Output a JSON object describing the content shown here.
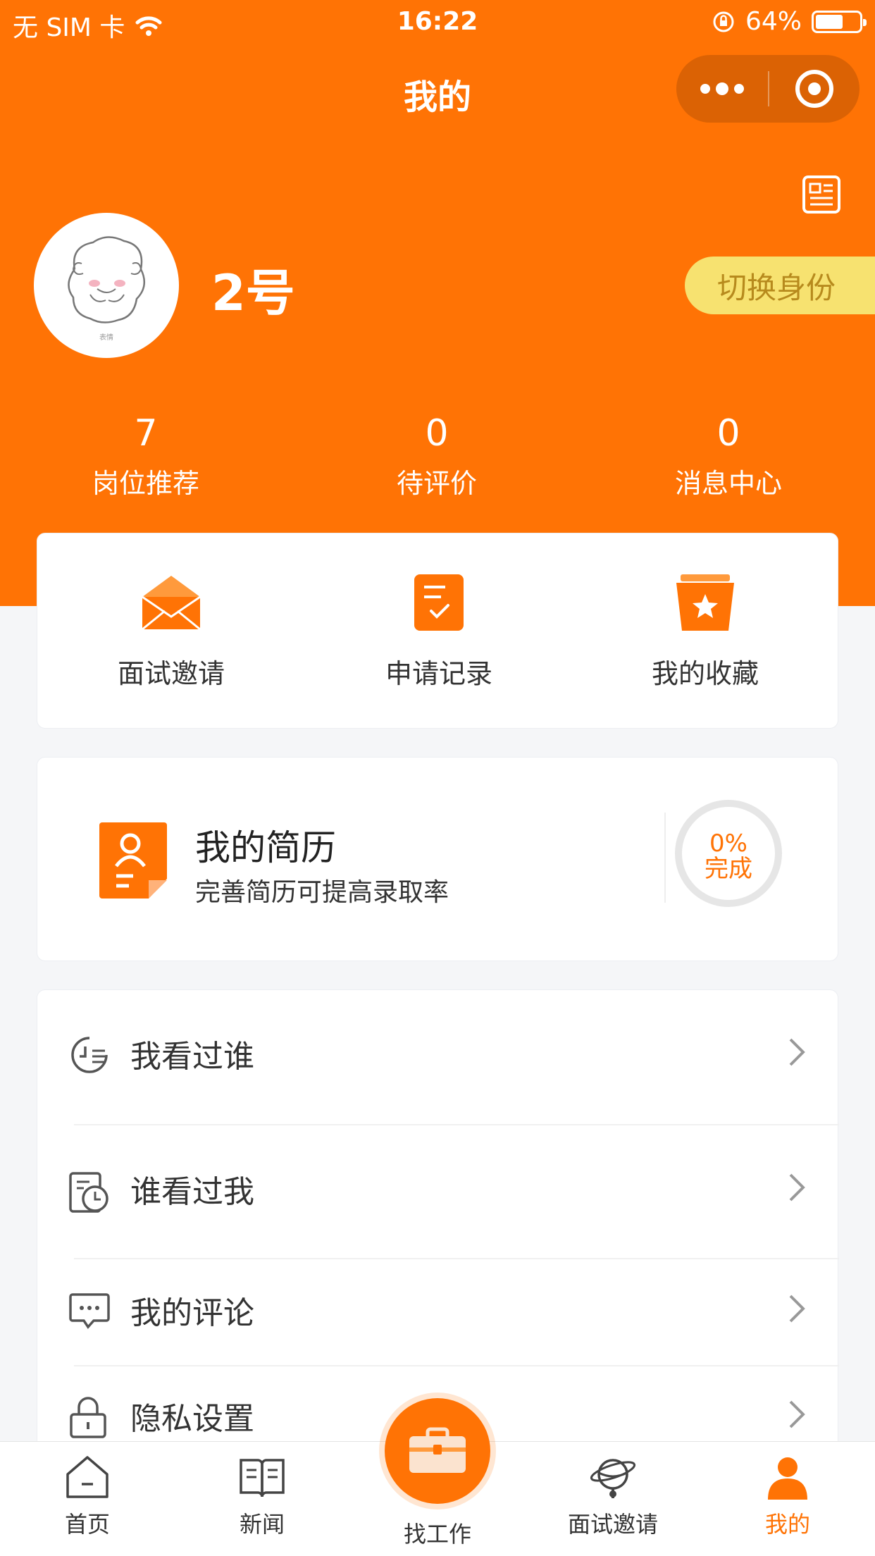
{
  "status_bar": {
    "carrier": "无 SIM 卡",
    "time": "16:22",
    "battery": "64%",
    "battery_level": 0.64
  },
  "nav": {
    "title": "我的"
  },
  "profile": {
    "username": "2号",
    "switch_label": "切换身份",
    "avatar_caption": "表情"
  },
  "stats": [
    {
      "value": "7",
      "label": "岗位推荐"
    },
    {
      "value": "0",
      "label": "待评价"
    },
    {
      "value": "0",
      "label": "消息中心"
    }
  ],
  "quick_actions": [
    {
      "label": "面试邀请",
      "icon": "envelope-icon"
    },
    {
      "label": "申请记录",
      "icon": "clipboard-check-icon"
    },
    {
      "label": "我的收藏",
      "icon": "star-box-icon"
    }
  ],
  "resume": {
    "title": "我的简历",
    "subtitle": "完善简历可提高录取率",
    "progress_text": "0%",
    "progress_label": "完成",
    "progress_value": 0
  },
  "menu": [
    {
      "label": "我看过谁",
      "icon": "history-icon"
    },
    {
      "label": "谁看过我",
      "icon": "calendar-clock-icon"
    },
    {
      "label": "我的评论",
      "icon": "comment-icon"
    },
    {
      "label": "隐私设置",
      "icon": "lock-icon"
    }
  ],
  "tabbar": [
    {
      "label": "首页",
      "icon": "home-icon"
    },
    {
      "label": "新闻",
      "icon": "book-icon"
    },
    {
      "label": "找工作",
      "icon": "briefcase-icon"
    },
    {
      "label": "面试邀请",
      "icon": "interview-icon"
    },
    {
      "label": "我的",
      "icon": "user-icon",
      "active": true
    }
  ],
  "colors": {
    "brand": "#ff7305",
    "switch_bg": "#f7e270",
    "switch_text": "#b78a1d",
    "page_bg": "#f5f6f8"
  }
}
